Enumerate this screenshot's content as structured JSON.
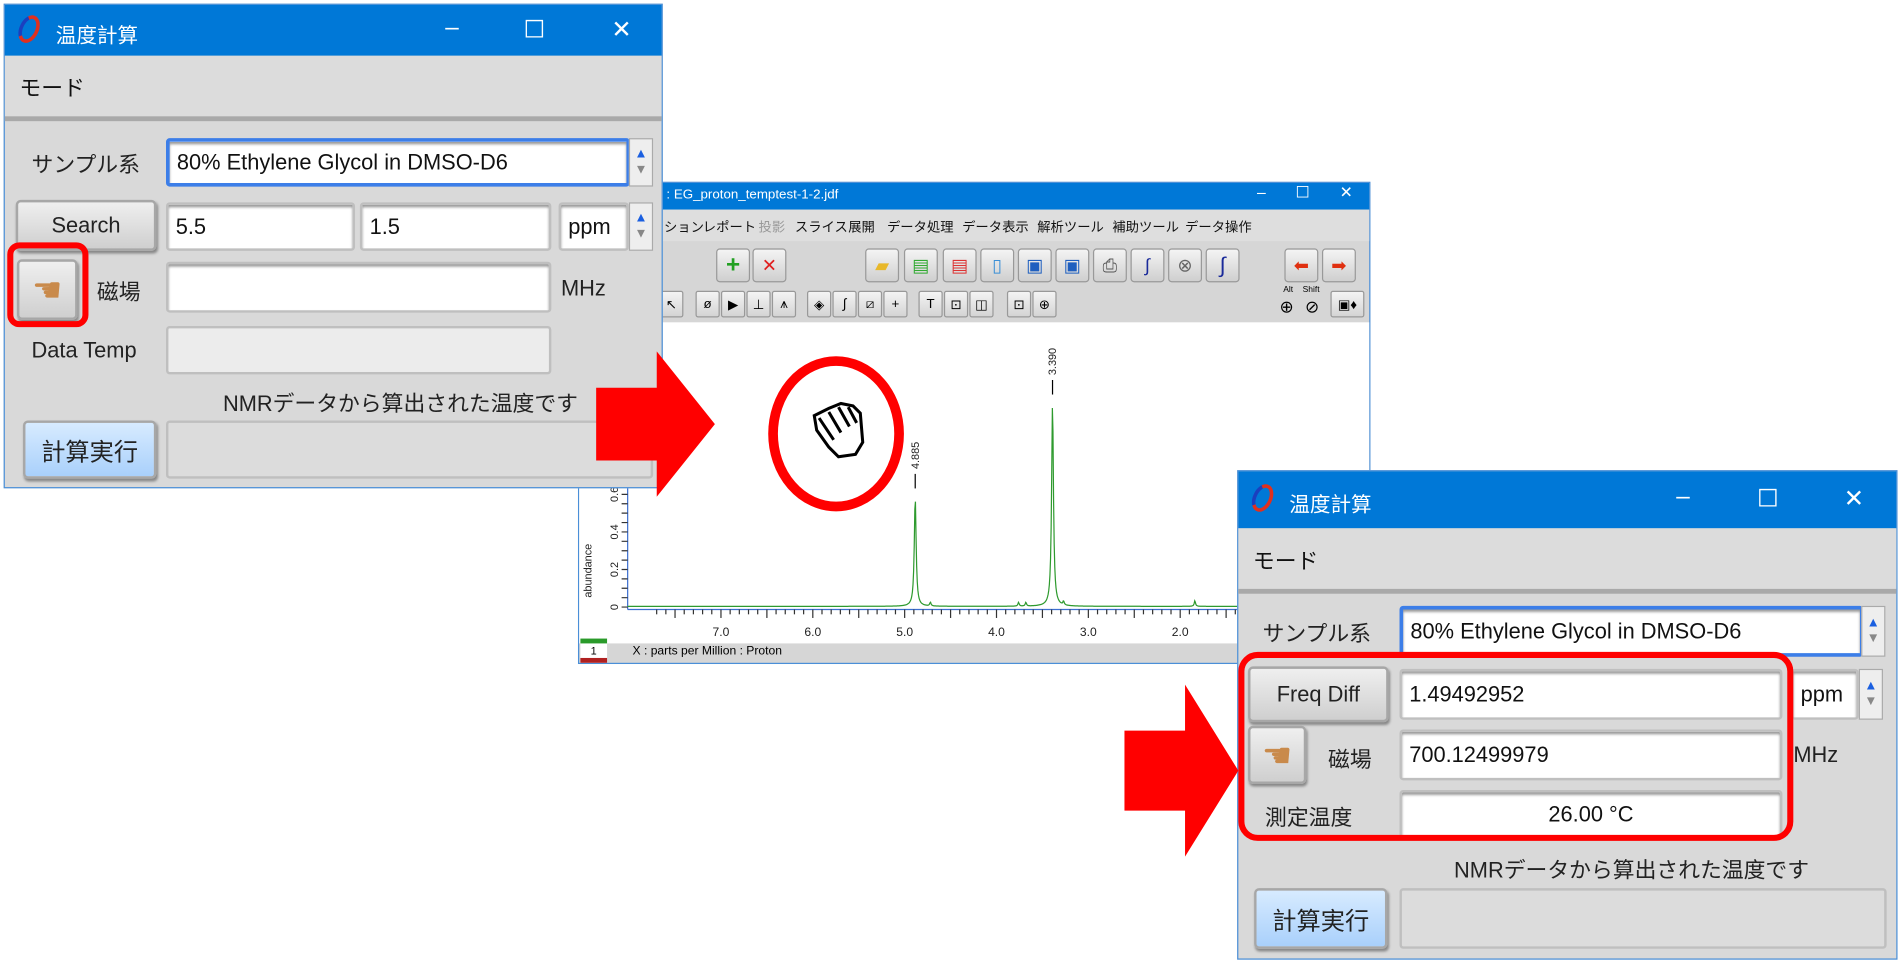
{
  "left_window": {
    "title": "温度計算",
    "menu": "モード",
    "sample_label": "サンプル系",
    "sample_value": "80% Ethylene Glycol in DMSO-D6",
    "search_button": "Search",
    "range_from": "5.5",
    "range_to": "1.5",
    "unit": "ppm",
    "field_label": "磁場",
    "field_value": "",
    "field_unit": "MHz",
    "temp_label": "Data Temp",
    "temp_value": "",
    "message": "NMRデータから算出された温度です",
    "run_button": "計算実行",
    "output": ""
  },
  "spectrum_window": {
    "title": ": EG_proton_temptest-1-2.jdf",
    "menu": [
      "ション",
      "レポート",
      "投影",
      "スライス",
      "展開",
      "データ処理",
      "データ表示",
      "解析ツール",
      "補助ツール",
      "データ操作"
    ],
    "menu_disabled": [
      "投影"
    ],
    "toolbar_row2_labels": {
      "alt": "Alt",
      "shift": "Shift"
    },
    "x_axis_label": "X : parts per Million : Proton",
    "y_axis_label": "abundance",
    "slice_number": "1",
    "chart_data": {
      "type": "line",
      "xlim": [
        7.9,
        1.3
      ],
      "ylim": [
        0,
        1.2
      ],
      "x_ticks": [
        "7.0",
        "6.0",
        "5.0",
        "4.0",
        "3.0",
        "2.0"
      ],
      "y_ticks": [
        "0",
        "0.2",
        "0.4",
        "0.6"
      ],
      "peaks": [
        {
          "ppm": 4.885,
          "label": "4.885",
          "height": 0.58
        },
        {
          "ppm": 3.39,
          "label": "3.390",
          "height": 1.08
        }
      ],
      "minor_peaks": [
        {
          "ppm": 4.72,
          "height": 0.02
        },
        {
          "ppm": 3.76,
          "height": 0.02
        },
        {
          "ppm": 3.68,
          "height": 0.02
        },
        {
          "ppm": 3.27,
          "height": 0.02
        },
        {
          "ppm": 1.84,
          "height": 0.03
        }
      ],
      "line_color": "#2e9a2e"
    }
  },
  "right_window": {
    "title": "温度計算",
    "menu": "モード",
    "sample_label": "サンプル系",
    "sample_value": "80% Ethylene Glycol in DMSO-D6",
    "freq_button": "Freq Diff",
    "freq_value": "1.49492952",
    "unit": "ppm",
    "field_label": "磁場",
    "field_value": "700.12499979",
    "field_unit": "MHz",
    "temp_label": "測定温度",
    "temp_value": "26.00 °C",
    "message": "NMRデータから算出された温度です",
    "run_button": "計算実行",
    "output": ""
  },
  "annotation_color": "#ff0000"
}
